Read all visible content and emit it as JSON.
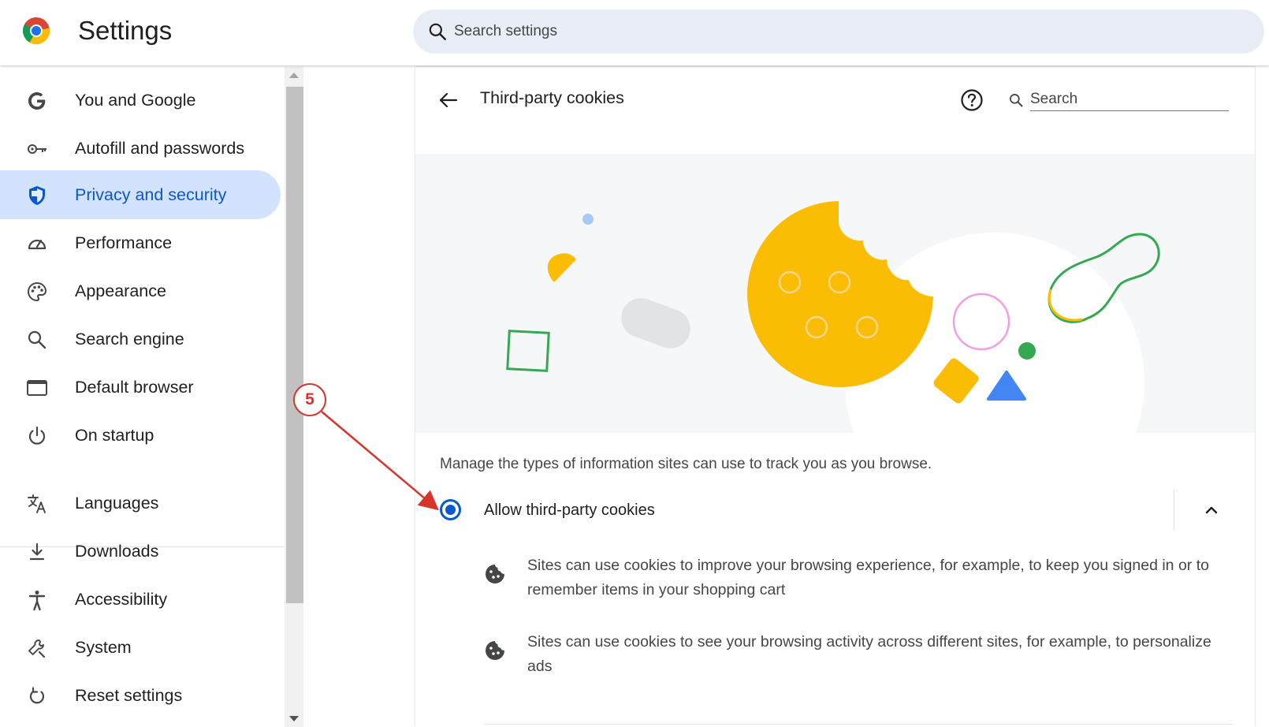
{
  "header": {
    "app_title": "Settings",
    "search_placeholder": "Search settings"
  },
  "sidebar": {
    "items": [
      {
        "label": "You and Google",
        "icon": "google-g-icon"
      },
      {
        "label": "Autofill and passwords",
        "icon": "key-icon"
      },
      {
        "label": "Privacy and security",
        "icon": "shield-icon",
        "active": true
      },
      {
        "label": "Performance",
        "icon": "speedometer-icon"
      },
      {
        "label": "Appearance",
        "icon": "palette-icon"
      },
      {
        "label": "Search engine",
        "icon": "search-icon"
      },
      {
        "label": "Default browser",
        "icon": "browser-window-icon"
      },
      {
        "label": "On startup",
        "icon": "power-icon"
      },
      {
        "label": "Languages",
        "icon": "translate-icon"
      },
      {
        "label": "Downloads",
        "icon": "download-icon"
      },
      {
        "label": "Accessibility",
        "icon": "accessibility-icon"
      },
      {
        "label": "System",
        "icon": "wrench-icon"
      },
      {
        "label": "Reset settings",
        "icon": "reset-icon"
      }
    ]
  },
  "main": {
    "title": "Third-party cookies",
    "search_placeholder": "Search",
    "description": "Manage the types of information sites can use to track you as you browse.",
    "option": {
      "label": "Allow third-party cookies",
      "selected": true,
      "expanded": true
    },
    "bullets": [
      "Sites can use cookies to improve your browsing experience, for example, to keep you signed in or to remember items in your shopping cart",
      "Sites can use cookies to see your browsing activity across different sites, for example, to personalize ads"
    ]
  },
  "annotation": {
    "step_number": "5"
  },
  "colors": {
    "accent": "#0b57d0",
    "active_nav_bg": "#d3e3fd",
    "annotation": "#d7342a",
    "cookie": "#fbbc04"
  }
}
